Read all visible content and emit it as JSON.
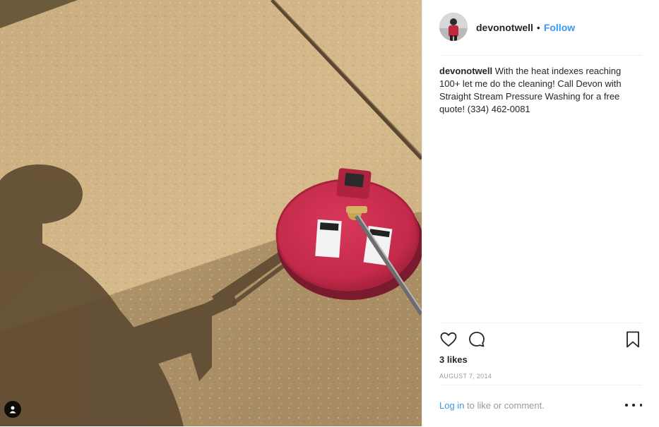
{
  "post": {
    "username": "devonotwell",
    "follow_label": "Follow",
    "separator": "•",
    "caption_username": "devonotwell",
    "caption_text": " With the heat indexes reaching 100+ let me do the cleaning! Call Devon with Straight Stream Pressure Washing for a free quote! (334) 462-0081",
    "likes": "3 likes",
    "date": "August 7, 2014",
    "login_label": "Log in",
    "comment_prompt": " to like or comment."
  },
  "icons": {
    "like": "heart-outline-icon",
    "comment": "comment-bubble-icon",
    "save": "bookmark-icon",
    "more": "more-options-icon",
    "tag": "user-tag-icon"
  },
  "colors": {
    "link": "#3897f0",
    "text": "#262626",
    "muted": "#999999",
    "divider": "#efefef",
    "cleaner_red": "#c8294a"
  }
}
